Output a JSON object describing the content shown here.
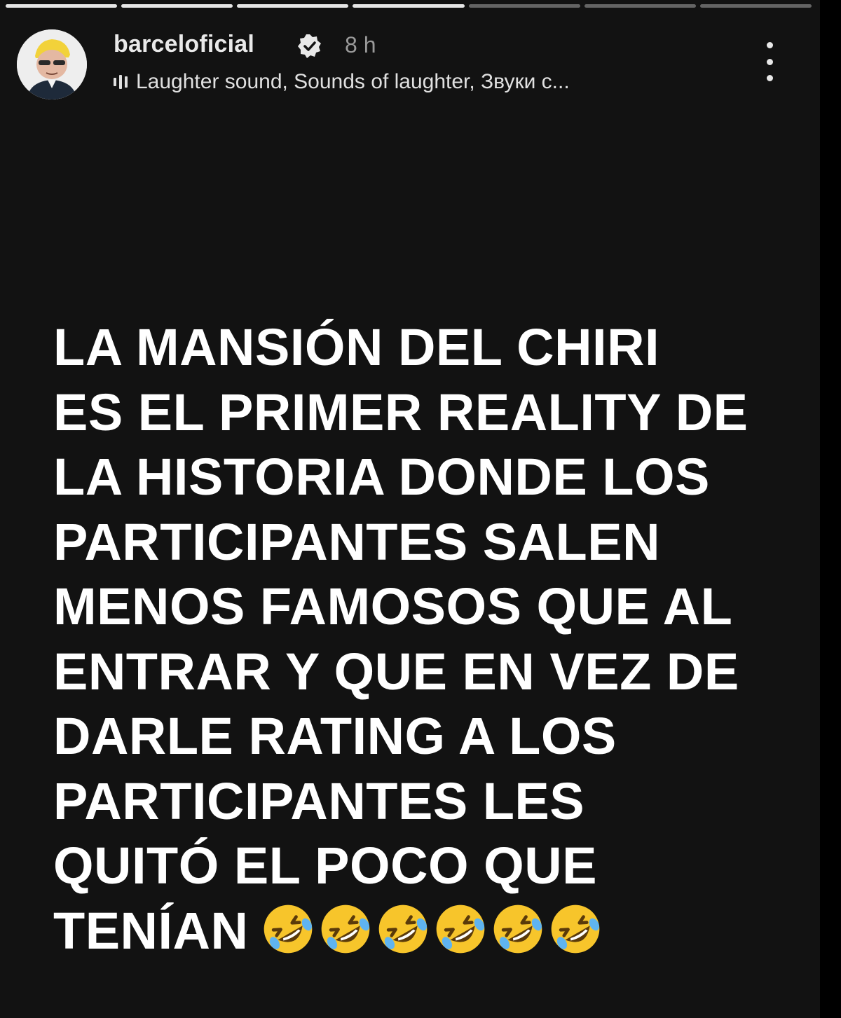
{
  "story": {
    "progress": {
      "segments": 7,
      "completed": 4
    },
    "header": {
      "username": "barceloficial",
      "verified": true,
      "time": "8 h",
      "music": "Laughter sound, Sounds of laughter, Звуки с..."
    },
    "text_lines": [
      "LA MANSIÓN DEL CHIRI",
      "ES EL PRIMER REALITY DE",
      "LA HISTORIA DONDE LOS",
      "PARTICIPANTES SALEN",
      "MENOS FAMOSOS QUE AL",
      "ENTRAR Y QUE EN VEZ DE",
      "DARLE RATING A LOS",
      "PARTICIPANTES LES",
      "QUITÓ EL POCO QUE",
      "TENÍAN"
    ],
    "emoji": {
      "name": "rolling-on-floor-laughing",
      "count": 6
    }
  },
  "colors": {
    "background": "#121212",
    "text": "#ffffff",
    "emoji_face": "#f7c52b"
  }
}
